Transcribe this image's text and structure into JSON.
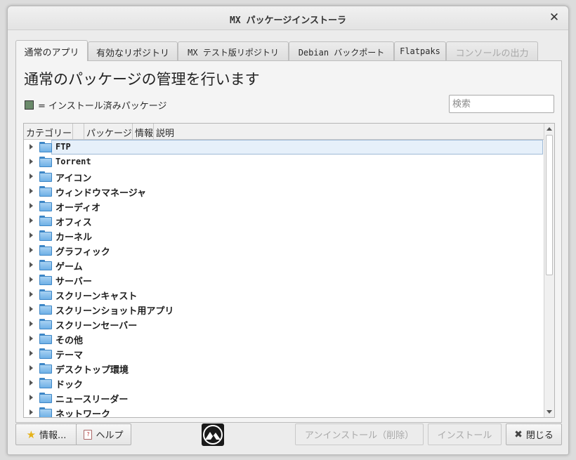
{
  "window": {
    "title": "MX パッケージインストーラ",
    "close_glyph": "✕"
  },
  "tabs": [
    {
      "label": "通常のアプリ",
      "state": "active"
    },
    {
      "label": "有効なリポジトリ",
      "state": "normal"
    },
    {
      "label": "MX テスト版リポジトリ",
      "state": "normal"
    },
    {
      "label": "Debian バックポート",
      "state": "normal"
    },
    {
      "label": "Flatpaks",
      "state": "normal"
    },
    {
      "label": "コンソールの出力",
      "state": "disabled"
    }
  ],
  "main": {
    "heading": "通常のパッケージの管理を行います",
    "legend_text": "= インストール済みパッケージ",
    "legend_color": "#6b8a6b",
    "search_placeholder": "検索"
  },
  "tree": {
    "columns": [
      "カテゴリー",
      "",
      "パッケージ",
      "情報",
      "説明"
    ],
    "rows": [
      "FTP",
      "Torrent",
      "アイコン",
      "ウィンドウマネージャ",
      "オーディオ",
      "オフィス",
      "カーネル",
      "グラフィック",
      "ゲーム",
      "サーバー",
      "スクリーンキャスト",
      "スクリーンショット用アプリ",
      "スクリーンセーバー",
      "その他",
      "テーマ",
      "デスクトップ環境",
      "ドック",
      "ニュースリーダー",
      "ネットワーク"
    ],
    "selected_index": 0,
    "row_icon": "folder-icon"
  },
  "buttons": {
    "about": {
      "label": "情報...",
      "icon": "star-icon"
    },
    "help": {
      "label": "ヘルプ",
      "icon": "help-book-icon"
    },
    "uninstall": {
      "label": "アンインストール（削除）",
      "enabled": false
    },
    "install": {
      "label": "インストール",
      "enabled": false
    },
    "close": {
      "label": "閉じる",
      "icon": "close-icon"
    }
  },
  "logo": "mx-logo"
}
